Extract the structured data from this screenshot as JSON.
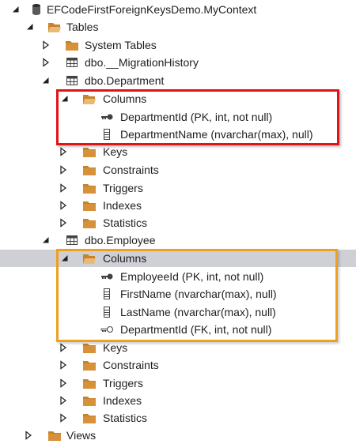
{
  "tree": {
    "root": {
      "label": "EFCodeFirstForeignKeysDemo.MyContext",
      "icon": "database-icon"
    },
    "tables": {
      "label": "Tables",
      "icon": "folder-open-icon"
    },
    "system_tables": {
      "label": "System Tables",
      "icon": "folder-icon"
    },
    "migration_history": {
      "label": "dbo.__MigrationHistory",
      "icon": "table-icon"
    },
    "department": {
      "label": "dbo.Department",
      "icon": "table-icon",
      "columns_label": "Columns",
      "columns": [
        {
          "label": "DepartmentId (PK, int, not null)",
          "icon": "primary-key-icon"
        },
        {
          "label": "DepartmentName (nvarchar(max), null)",
          "icon": "column-icon"
        }
      ],
      "children": [
        "Keys",
        "Constraints",
        "Triggers",
        "Indexes",
        "Statistics"
      ]
    },
    "employee": {
      "label": "dbo.Employee",
      "icon": "table-icon",
      "columns_label": "Columns",
      "columns": [
        {
          "label": "EmployeeId (PK, int, not null)",
          "icon": "primary-key-icon"
        },
        {
          "label": "FirstName (nvarchar(max), null)",
          "icon": "column-icon"
        },
        {
          "label": "LastName (nvarchar(max), null)",
          "icon": "column-icon"
        },
        {
          "label": "DepartmentId (FK, int, not null)",
          "icon": "foreign-key-icon"
        }
      ],
      "children": [
        "Keys",
        "Constraints",
        "Triggers",
        "Indexes",
        "Statistics"
      ]
    },
    "views": {
      "label": "Views",
      "icon": "folder-icon"
    }
  },
  "colors": {
    "folder": "#c8822a",
    "selection": "#cfcfd6",
    "highlight_red": "#e01414",
    "highlight_orange": "#f0a020"
  }
}
